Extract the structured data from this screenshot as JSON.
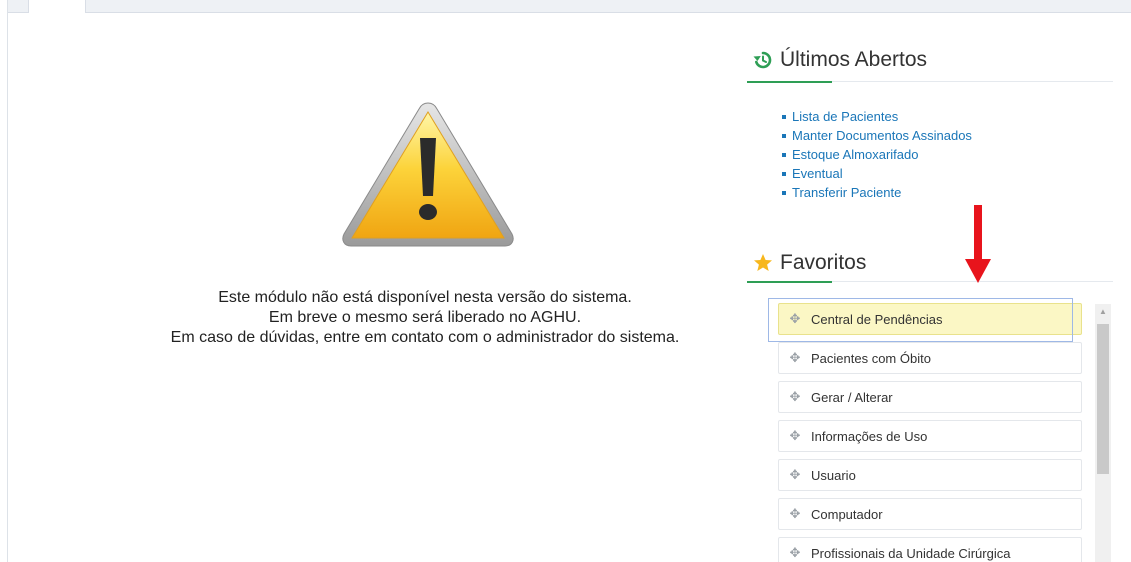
{
  "message": {
    "line1": "Este módulo não está disponível nesta versão do sistema.",
    "line2": "Em breve o mesmo será liberado no AGHU.",
    "line3": "Em caso de dúvidas, entre em contato com o administrador do sistema."
  },
  "recent": {
    "title": "Últimos Abertos",
    "icon": "history-icon",
    "items": [
      "Lista de Pacientes",
      "Manter Documentos Assinados",
      "Estoque Almoxarifado",
      "Eventual",
      "Transferir Paciente"
    ]
  },
  "favorites": {
    "title": "Favoritos",
    "icon": "star-icon",
    "items": [
      "Central de Pendências",
      "Pacientes com Óbito",
      "Gerar / Alterar",
      "Informações de Uso",
      "Usuario",
      "Computador",
      "Profissionais da Unidade Cirúrgica"
    ]
  },
  "colors": {
    "link": "#1a76b8",
    "accent": "#2e9e55",
    "highlight": "#fbf7c5",
    "arrow": "#e8141c"
  }
}
